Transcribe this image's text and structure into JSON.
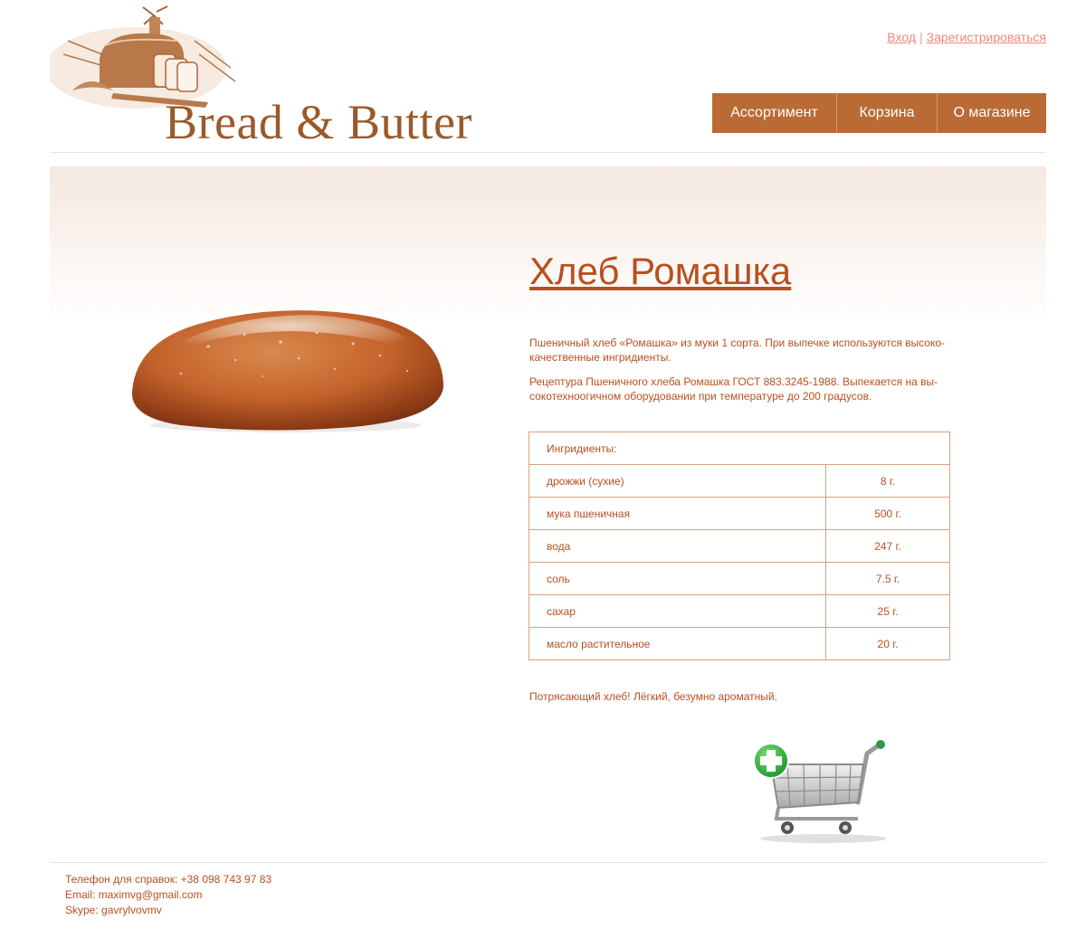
{
  "brand": {
    "logo_text": "Bread & Butter"
  },
  "auth": {
    "login": "Вход",
    "separator": "|",
    "register": "Зарегистрироваться"
  },
  "nav": {
    "items": [
      {
        "label": "Ассортимент"
      },
      {
        "label": "Корзина"
      },
      {
        "label": "О магазине"
      }
    ]
  },
  "product": {
    "title": "Хлеб Ромашка",
    "description_1": "Пшеничный хлеб «Ромашка» из муки 1 сорта. При выпечке используются высоко-качественные ингридиенты.",
    "description_2": "Рецептура Пшеничного хлеба Ромашка ГОСТ 883.3245-1988. Выпекается на вы-сокотехноогичном оборудовании при температуре до 200 градусов.",
    "ingredients_header": "Ингридиенты:",
    "ingredients": [
      {
        "name": "дрожжи (сухие)",
        "amount": "8 г."
      },
      {
        "name": "мука пшеничная",
        "amount": "500 г."
      },
      {
        "name": "вода",
        "amount": "247 г."
      },
      {
        "name": "соль",
        "amount": "7.5 г."
      },
      {
        "name": "сахар",
        "amount": "25 г."
      },
      {
        "name": "масло растительное",
        "amount": "20 г."
      }
    ],
    "note": "Потрясающий хлеб! Лёгкий, безумно ароматный."
  },
  "icons": {
    "cart": "add-to-cart-icon",
    "plus": "plus-icon"
  },
  "colors": {
    "accent": "#b96a35",
    "text": "#b8501f",
    "link": "#e8897a"
  },
  "footer": {
    "phone": "Телефон для справок: +38 098 743 97 83",
    "email": "Email: maximvg@gmail.com",
    "skype": "Skype: gavrylvovmv"
  }
}
